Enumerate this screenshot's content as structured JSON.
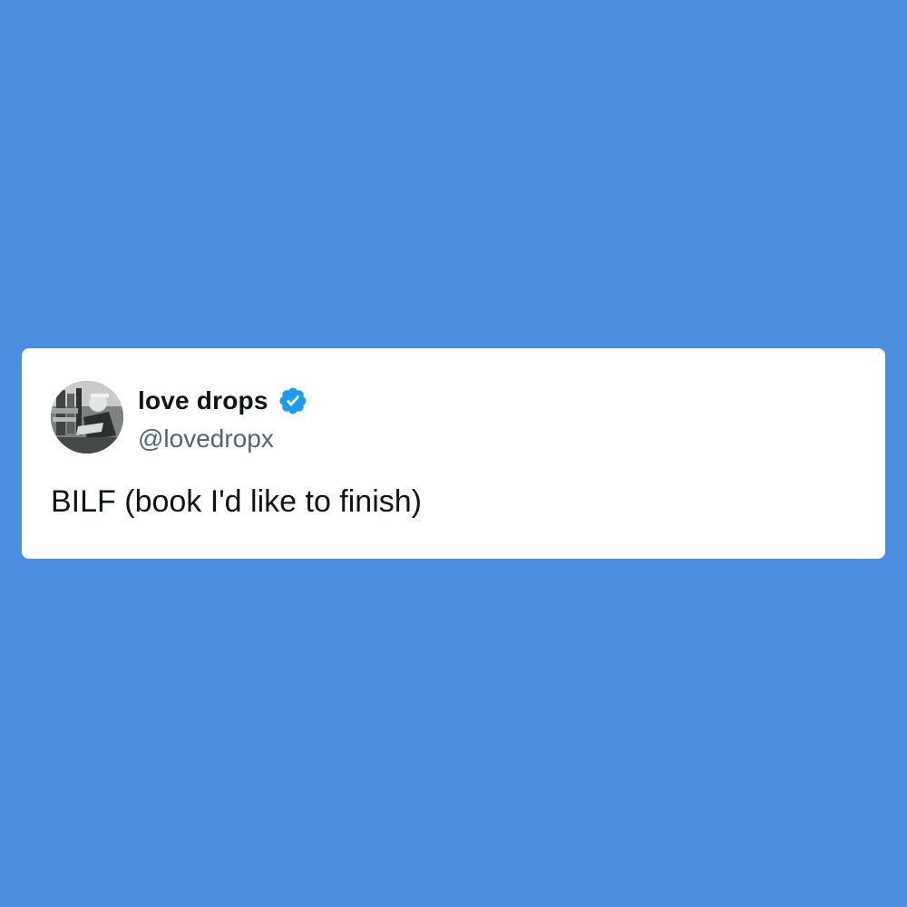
{
  "tweet": {
    "author": {
      "display_name": "love drops",
      "handle": "@lovedropx",
      "verified_icon": "verified-badge-icon",
      "avatar": "profile-photo"
    },
    "text": "BILF (book I'd like to finish)"
  },
  "colors": {
    "background": "#4a8fe0",
    "card": "#ffffff",
    "name": "#0f1419",
    "handle": "#536471",
    "verified": "#1d9bf0"
  }
}
